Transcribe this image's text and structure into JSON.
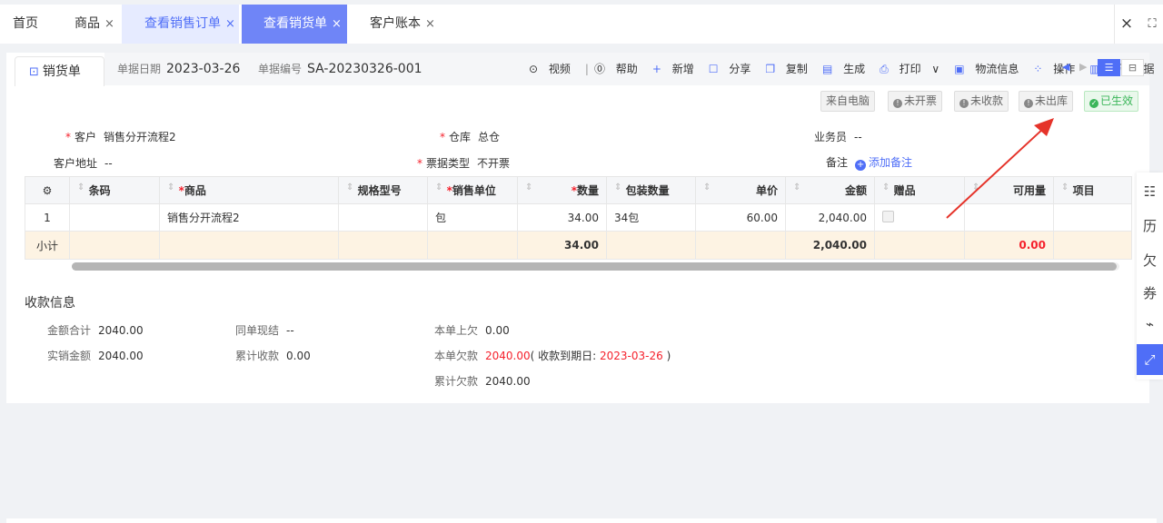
{
  "tabs": [
    {
      "label": "首页",
      "closable": false,
      "state": "normal"
    },
    {
      "label": "商品",
      "closable": true,
      "state": "normal"
    },
    {
      "label": "查看销售订单",
      "closable": true,
      "state": "light"
    },
    {
      "label": "查看销货单",
      "closable": true,
      "state": "active"
    },
    {
      "label": "客户账本",
      "closable": true,
      "state": "normal"
    }
  ],
  "tab_close_symbol": "×",
  "tabbar_icons": {
    "close_all": "×",
    "fullscreen": "⛶"
  },
  "doc": {
    "title": "销货单",
    "date_label": "单据日期",
    "date_value": "2023-03-26",
    "number_label": "单据编号",
    "number_value": "SA-20230326-001"
  },
  "toolbar": {
    "video": "视频",
    "separator": "|",
    "help": "帮助",
    "add": "新增",
    "share": "分享",
    "copy": "复制",
    "generate": "生成",
    "print": "打印",
    "logistics": "物流信息",
    "operate": "操作",
    "history": "历史单据"
  },
  "status_badges": [
    {
      "label": "来自电脑",
      "icon": "",
      "state": "plain"
    },
    {
      "label": "未开票",
      "icon": "!",
      "state": "pending"
    },
    {
      "label": "未收款",
      "icon": "!",
      "state": "pending"
    },
    {
      "label": "未出库",
      "icon": "!",
      "state": "pending"
    },
    {
      "label": "已生效",
      "icon": "✓",
      "state": "ok"
    }
  ],
  "form": {
    "customer_label": "客户",
    "customer_value": "销售分开流程2",
    "address_label": "客户地址",
    "address_value": "--",
    "warehouse_label": "仓库",
    "warehouse_value": "总仓",
    "invoice_type_label": "票据类型",
    "invoice_type_value": "不开票",
    "salesman_label": "业务员",
    "salesman_value": "--",
    "remark_label": "备注",
    "remark_action": "添加备注"
  },
  "table": {
    "headers": {
      "settings": "⚙",
      "barcode": "条码",
      "product": "商品",
      "spec": "规格型号",
      "sale_unit": "销售单位",
      "qty": "数量",
      "pack_qty": "包装数量",
      "unit_price": "单价",
      "amount": "金额",
      "gift": "赠品",
      "available": "可用量",
      "project": "项目"
    },
    "rows": [
      {
        "no": "1",
        "barcode": "",
        "product": "销售分开流程2",
        "spec": "",
        "sale_unit": "包",
        "qty": "34.00",
        "pack_qty": "34包",
        "unit_price": "60.00",
        "amount": "2,040.00",
        "gift": false,
        "available": "",
        "project": ""
      }
    ],
    "subtotal": {
      "label": "小计",
      "qty": "34.00",
      "amount": "2,040.00",
      "available": "0.00"
    }
  },
  "payment": {
    "title": "收款信息",
    "total_label": "金额合计",
    "total_value": "2040.00",
    "actual_label": "实销金额",
    "actual_value": "2040.00",
    "settle_label": "同单现结",
    "settle_value": "--",
    "cumulative_recv_label": "累计收款",
    "cumulative_recv_value": "0.00",
    "prev_debt_label": "本单上欠",
    "prev_debt_value": "0.00",
    "this_debt_label": "本单欠款",
    "this_debt_value": "2040.00",
    "due_text_prefix": "( 收款到期日: ",
    "due_date": "2023-03-26",
    "due_text_suffix": " )",
    "total_debt_label": "累计欠款",
    "total_debt_value": "2040.00"
  },
  "rail": [
    {
      "icon": "invoice-icon",
      "glyph": "☷"
    },
    {
      "icon": "history-icon",
      "glyph": "历"
    },
    {
      "icon": "debt-icon",
      "glyph": "欠"
    },
    {
      "icon": "coupon-icon",
      "glyph": "券"
    },
    {
      "icon": "attachment-icon",
      "glyph": "⌁"
    },
    {
      "icon": "expand-icon",
      "glyph": "⤢"
    }
  ],
  "colors": {
    "accent": "#4f6ef7",
    "danger": "#f5222d",
    "success": "#3cb65a",
    "subtotal_bg": "#fdf3e3",
    "annotation_arrow": "#e5332a"
  }
}
